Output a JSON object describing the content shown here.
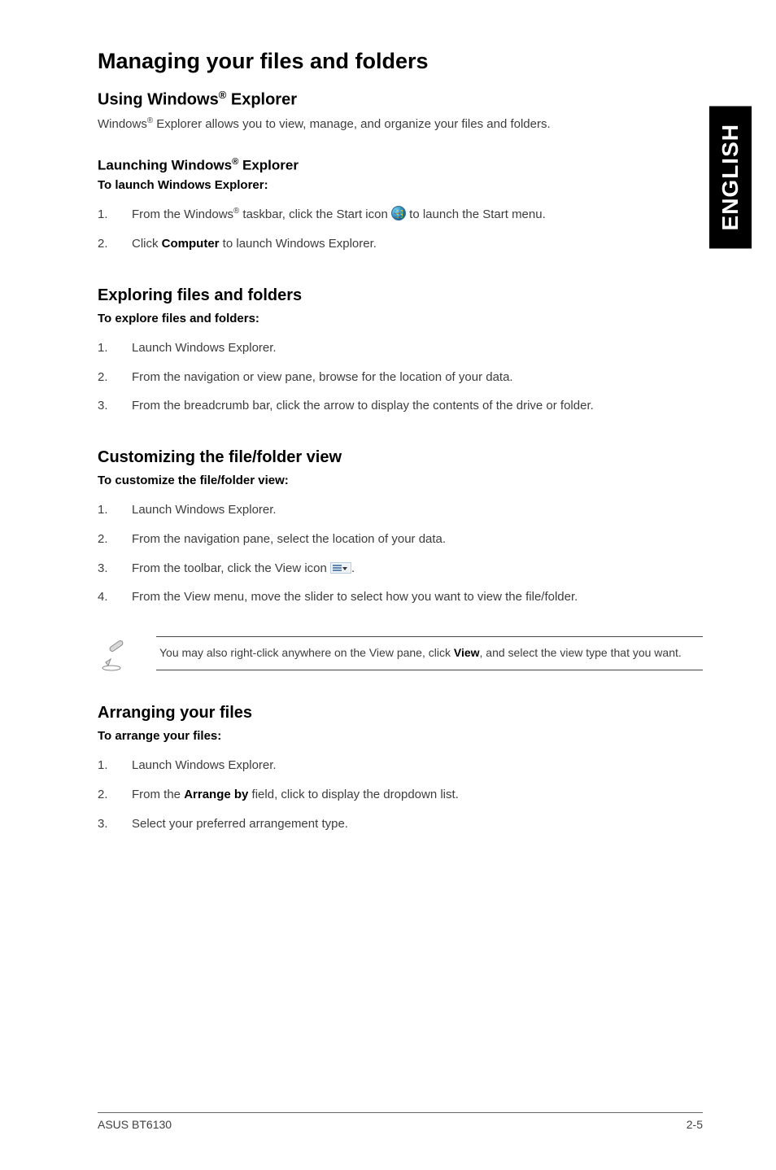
{
  "side_tab": "ENGLISH",
  "h1": "Managing your files and folders",
  "section_using": {
    "heading_pre": "Using Windows",
    "heading_post": " Explorer",
    "intro_pre": "Windows",
    "intro_post": " Explorer allows you to view, manage, and organize your files and folders."
  },
  "section_launch": {
    "heading_pre": "Launching Windows",
    "heading_post": " Explorer",
    "subheading": "To launch Windows Explorer:",
    "steps": [
      {
        "num": "1.",
        "pre": "From the Windows",
        "mid": " taskbar, click the Start icon ",
        "post": " to launch the Start menu.",
        "icon": "start"
      },
      {
        "num": "2.",
        "pre": "Click ",
        "bold": "Computer",
        "post": " to launch Windows Explorer."
      }
    ]
  },
  "section_explore": {
    "heading": "Exploring files and folders",
    "subheading": "To explore files and folders:",
    "steps": [
      {
        "num": "1.",
        "text": "Launch Windows Explorer."
      },
      {
        "num": "2.",
        "text": "From the navigation or view pane, browse for the location of your data."
      },
      {
        "num": "3.",
        "text": "From the breadcrumb bar, click the arrow to display the contents of the drive or folder."
      }
    ]
  },
  "section_customize": {
    "heading": "Customizing the file/folder view",
    "subheading": "To customize the file/folder view:",
    "steps": [
      {
        "num": "1.",
        "text": "Launch Windows Explorer."
      },
      {
        "num": "2.",
        "text": "From the navigation pane, select the location of your data."
      },
      {
        "num": "3.",
        "pre": "From the toolbar, click the View icon ",
        "post": ".",
        "icon": "view"
      },
      {
        "num": "4.",
        "text": "From the View menu, move the slider to select how you want to view the file/folder."
      }
    ],
    "note_pre": "You may also right-click anywhere on the View pane, click ",
    "note_bold": "View",
    "note_post": ", and select the view type that you want."
  },
  "section_arrange": {
    "heading": "Arranging your files",
    "subheading": "To arrange your files:",
    "steps": [
      {
        "num": "1.",
        "text": "Launch Windows Explorer."
      },
      {
        "num": "2.",
        "pre": "From the ",
        "bold": "Arrange by",
        "post": " field, click to display the dropdown list."
      },
      {
        "num": "3.",
        "text": "Select your preferred arrangement type."
      }
    ]
  },
  "footer": {
    "left": "ASUS BT6130",
    "right": "2-5"
  },
  "sup": "®"
}
